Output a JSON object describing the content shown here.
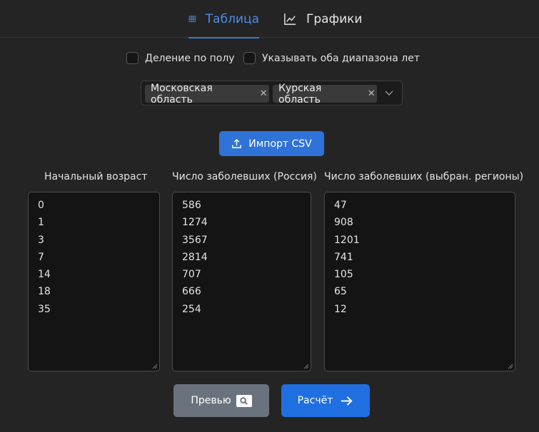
{
  "tabs": [
    {
      "label": "Таблица",
      "icon": "table-icon",
      "active": true
    },
    {
      "label": "Графики",
      "icon": "chart-line-icon",
      "active": false
    }
  ],
  "options": {
    "split_by_sex": {
      "label": "Деление по полу",
      "checked": false
    },
    "both_year_ranges": {
      "label": "Указывать оба диапазона лет",
      "checked": false
    }
  },
  "regions": {
    "selected": [
      "Московская область",
      "Курская область"
    ]
  },
  "import_button": {
    "label": "Импорт CSV",
    "icon": "upload-icon"
  },
  "columns": [
    {
      "label": "Начальный возраст",
      "values": [
        "0",
        "1",
        "3",
        "7",
        "14",
        "18",
        "35"
      ]
    },
    {
      "label": "Число заболевших (Россия)",
      "values": [
        "586",
        "1274",
        "3567",
        "2814",
        "707",
        "666",
        "254"
      ]
    },
    {
      "label": "Число заболевших (выбран. регионы)",
      "values": [
        "47",
        "908",
        "1201",
        "741",
        "105",
        "65",
        "12"
      ]
    }
  ],
  "actions": {
    "preview_label": "Превью",
    "calculate_label": "Расчёт"
  },
  "colors": {
    "background": "#242424",
    "accent": "#2f73d9",
    "active_tab": "#4e8de6",
    "preview_button": "#6a737d"
  }
}
